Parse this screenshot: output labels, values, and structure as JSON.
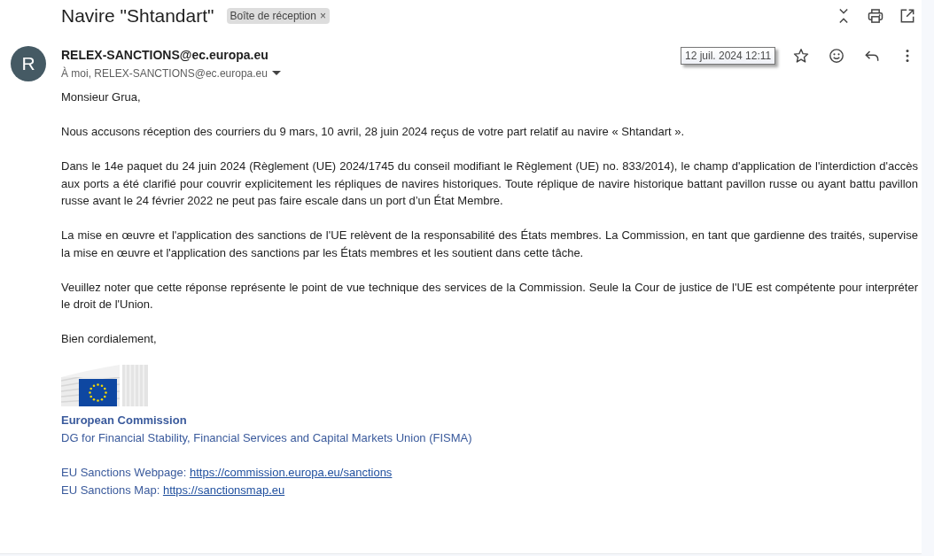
{
  "subject": {
    "title": "Navire \"Shtandart\"",
    "labels": [
      {
        "name": "Boîte de réception",
        "remove": "×"
      }
    ]
  },
  "message": {
    "avatar": "R",
    "sender": "RELEX-SANCTIONS@ec.europa.eu",
    "recipients": "À moi, RELEX-SANCTIONS@ec.europa.eu",
    "date_tooltip": "12 juil. 2024 12:11",
    "body": [
      "Monsieur Grua,",
      "Nous accusons réception des courriers du 9 mars, 10 avril, 28 juin 2024 reçus de votre part relatif au navire « Shtandart ».",
      "Dans le 14e paquet du 24 juin 2024 (Règlement (UE) 2024/1745 du conseil modifiant le Règlement (UE) no. 833/2014), le champ d'application de l'interdiction d'accès aux ports a été clarifié pour couvrir explicitement les répliques de navires historiques. Toute réplique de navire historique battant pavillon russe ou ayant battu pavillon russe avant le 24 février 2022 ne peut pas faire escale dans un port d’un État Membre.",
      "La mise en œuvre et l'application des sanctions de l'UE relèvent de la responsabilité des États membres. La Commission, en tant que gardienne des traités, supervise la mise en œuvre et l'application des sanctions par les États membres et les soutient dans cette tâche.",
      "Veuillez noter que cette réponse représente le point de vue technique des services de la Commission. Seule la Cour de justice de l'UE est compétente pour interpréter le droit de l'Union.",
      "Bien cordialement,"
    ],
    "signature": {
      "organization": "European Commission",
      "department": "DG for Financial Stability, Financial Services and Capital Markets Union (FISMA)",
      "links": [
        {
          "caption": "EU Sanctions Webpage:",
          "url": "https://commission.europa.eu/sanctions"
        },
        {
          "caption": "EU Sanctions Map:",
          "url": "https://sanctionsmap.eu"
        }
      ]
    }
  }
}
